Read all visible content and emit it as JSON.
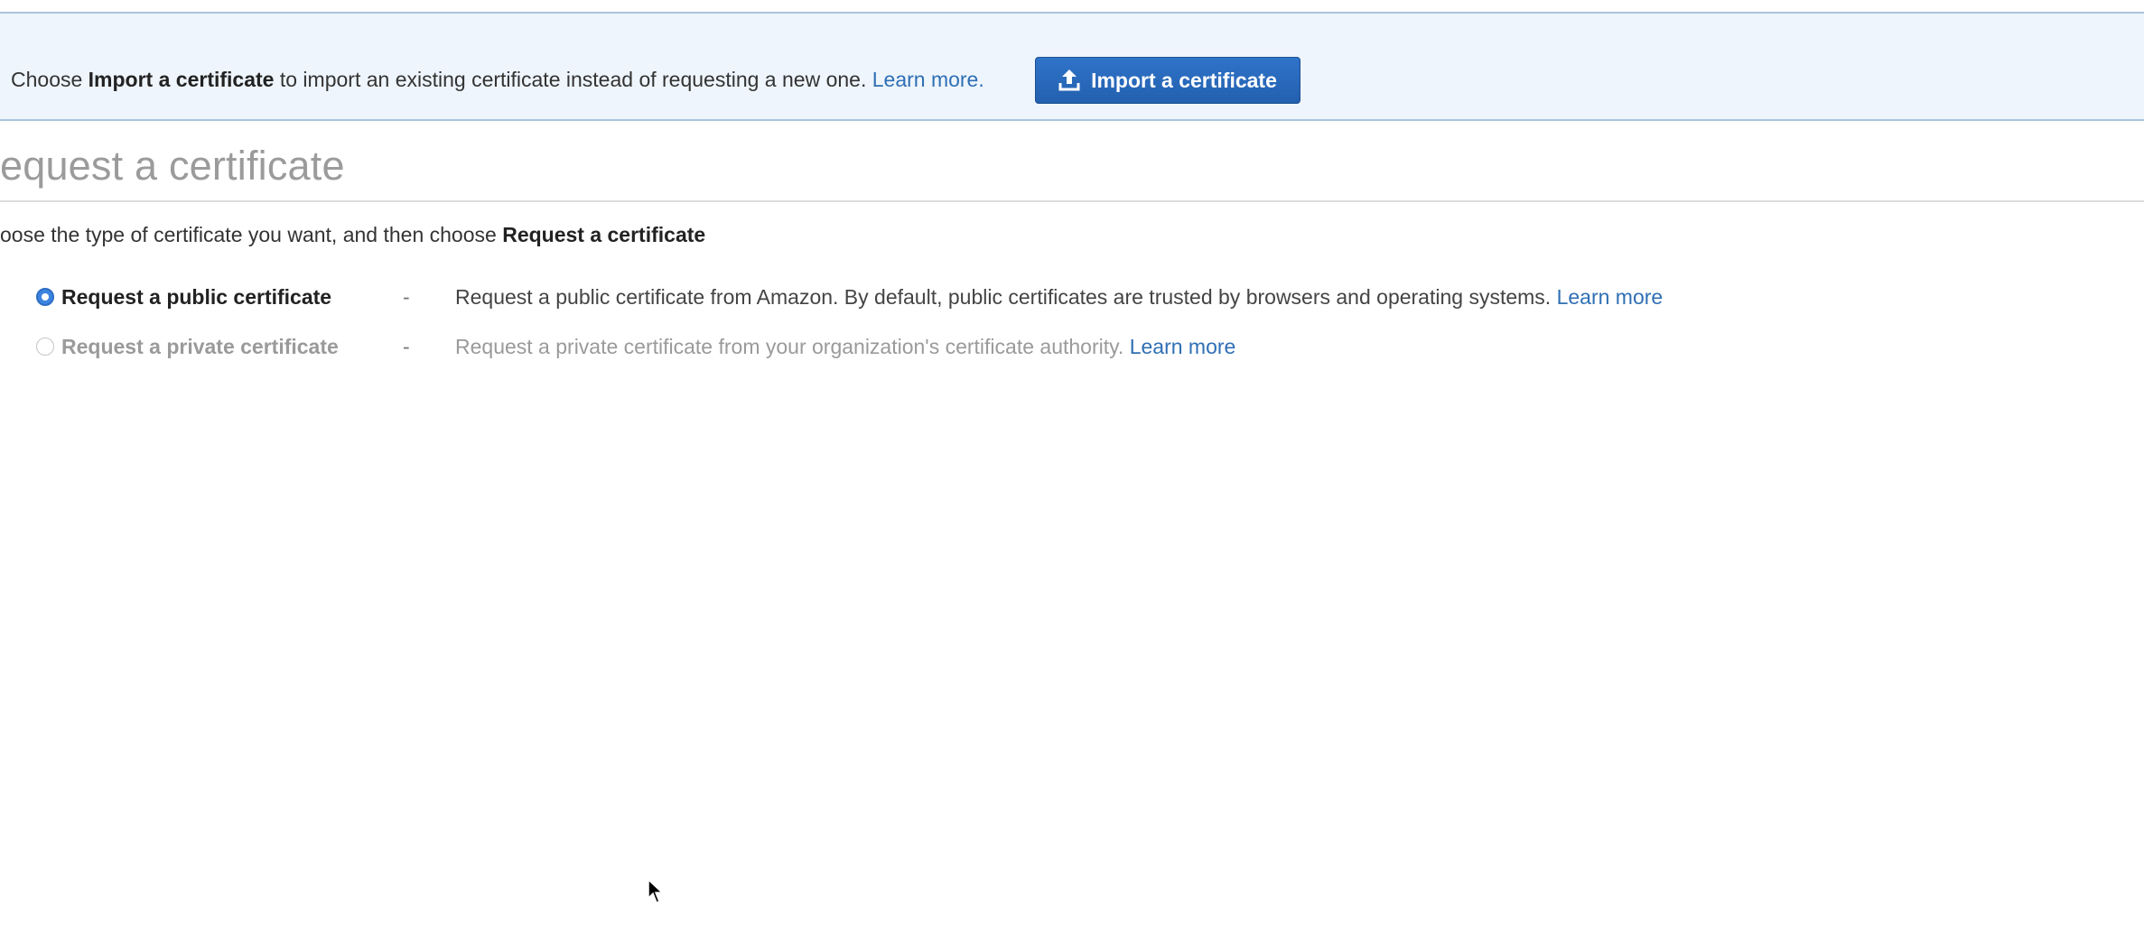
{
  "banner": {
    "text_prefix": "Choose ",
    "text_bold": "Import a certificate",
    "text_suffix": " to import an existing certificate instead of requesting a new one.",
    "learn_more": "Learn more.",
    "import_button_label": "Import a certificate",
    "import_button_icon": "upload-icon"
  },
  "main": {
    "title": "equest a certificate",
    "instruction_prefix": "oose the type of certificate you want, and then choose ",
    "instruction_bold": "Request a certificate"
  },
  "options": [
    {
      "label": "Request a public certificate",
      "separator": "-",
      "description": "Request a public certificate from Amazon. By default, public certificates are trusted by browsers and operating systems.",
      "learn_more": "Learn more",
      "selected": true
    },
    {
      "label": "Request a private certificate",
      "separator": "-",
      "description": "Request a private certificate from your organization's certificate authority.",
      "learn_more": "Learn more",
      "selected": false
    }
  ],
  "colors": {
    "accent": "#2f6fb4",
    "button": "#2a6abf",
    "banner_bg": "#eef5fc"
  }
}
